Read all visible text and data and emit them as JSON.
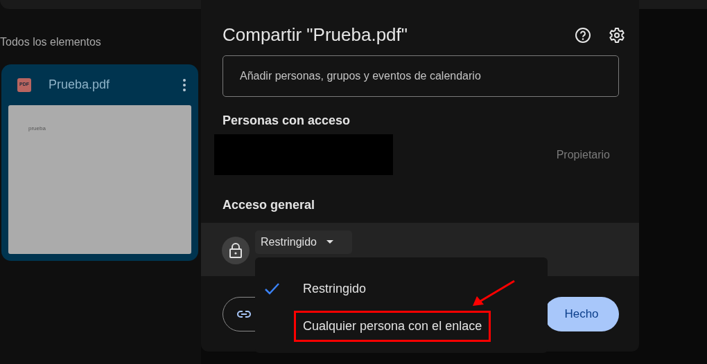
{
  "section_title": "Todos los elementos",
  "file_card": {
    "name": "Prueba.pdf",
    "file_type": "PDF",
    "preview_text": "prueba",
    "selected": true
  },
  "dialog": {
    "title": "Compartir \"Prueba.pdf\"",
    "add_field": {
      "placeholder": "Añadir personas, grupos y eventos de calendario"
    },
    "people_heading": "Personas con acceso",
    "people": [
      {
        "role": "Propietario",
        "redacted": true
      }
    ],
    "general_heading": "Acceso general",
    "access_button": "Restringido",
    "access_menu": [
      {
        "label": "Restringido",
        "selected": true,
        "highlighted": false
      },
      {
        "label": "Cualquier persona con el enlace",
        "selected": false,
        "highlighted": true
      }
    ],
    "done_button": "Hecho"
  }
}
